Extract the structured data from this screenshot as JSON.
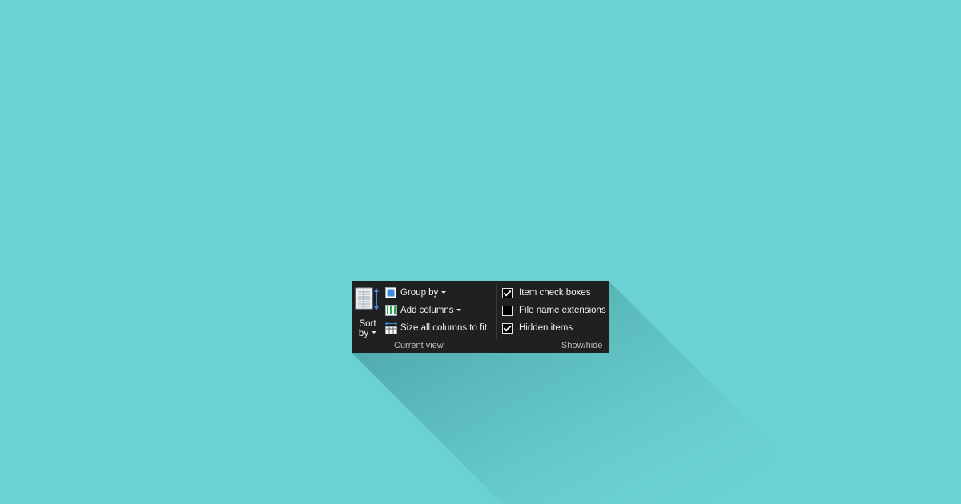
{
  "colors": {
    "background": "#6bd2d3",
    "ribbon": "#202020",
    "text": "#f2f2f2",
    "group_label": "#bcbcbc"
  },
  "current_view": {
    "sort_by": {
      "line1": "Sort",
      "line2": "by",
      "icon": "sort-by-icon"
    },
    "group_by": {
      "label": "Group by",
      "icon": "group-by-icon"
    },
    "add_columns": {
      "label": "Add columns",
      "icon": "add-columns-icon"
    },
    "size_columns": {
      "label": "Size all columns to fit",
      "icon": "size-columns-icon"
    },
    "group_label": "Current view"
  },
  "show_hide": {
    "options": [
      {
        "label": "Item check boxes",
        "checked": true
      },
      {
        "label": "File name extensions",
        "checked": false
      },
      {
        "label": "Hidden items",
        "checked": true
      }
    ],
    "group_label": "Show/hide"
  }
}
